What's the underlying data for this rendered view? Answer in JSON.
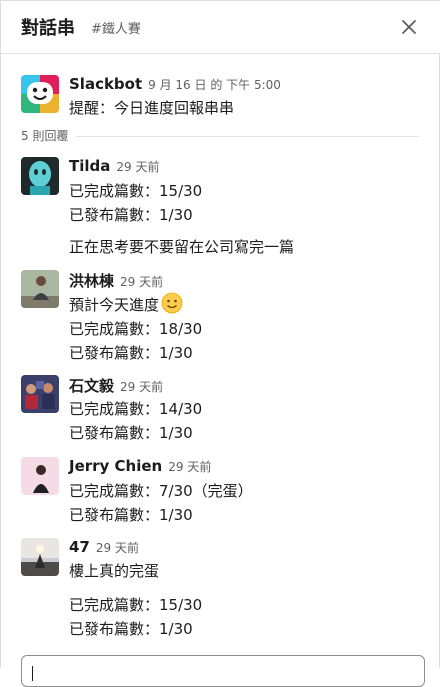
{
  "header": {
    "title": "對話串",
    "channel": "#鐵人賽"
  },
  "parent": {
    "author": "Slackbot",
    "time": "9 月 16 日 的 下午 5:00",
    "text": "提醒：今日進度回報串串"
  },
  "reply_count": "5 則回覆",
  "replies": [
    {
      "author": "Tilda",
      "time": "29 天前",
      "lines": [
        "已完成篇數：15/30",
        "已發布篇數：1/30",
        "",
        "正在思考要不要留在公司寫完一篇"
      ]
    },
    {
      "author": "洪林棟",
      "time": "29 天前",
      "lines": [
        "預計今天進度",
        "已完成篇數：18/30",
        "已發布篇數：1/30"
      ],
      "emoji": "slightly-smiling-face"
    },
    {
      "author": "石文毅",
      "time": "29 天前",
      "lines": [
        "已完成篇數：14/30",
        "已發布篇數：1/30"
      ]
    },
    {
      "author": "Jerry Chien",
      "time": "29 天前",
      "lines": [
        "已完成篇數：7/30（完蛋）",
        "已發布篇數：1/30"
      ]
    },
    {
      "author": "47",
      "time": "29 天前",
      "lines": [
        "樓上真的完蛋",
        "",
        "已完成篇數：15/30",
        "已發布篇數：1/30"
      ]
    }
  ]
}
